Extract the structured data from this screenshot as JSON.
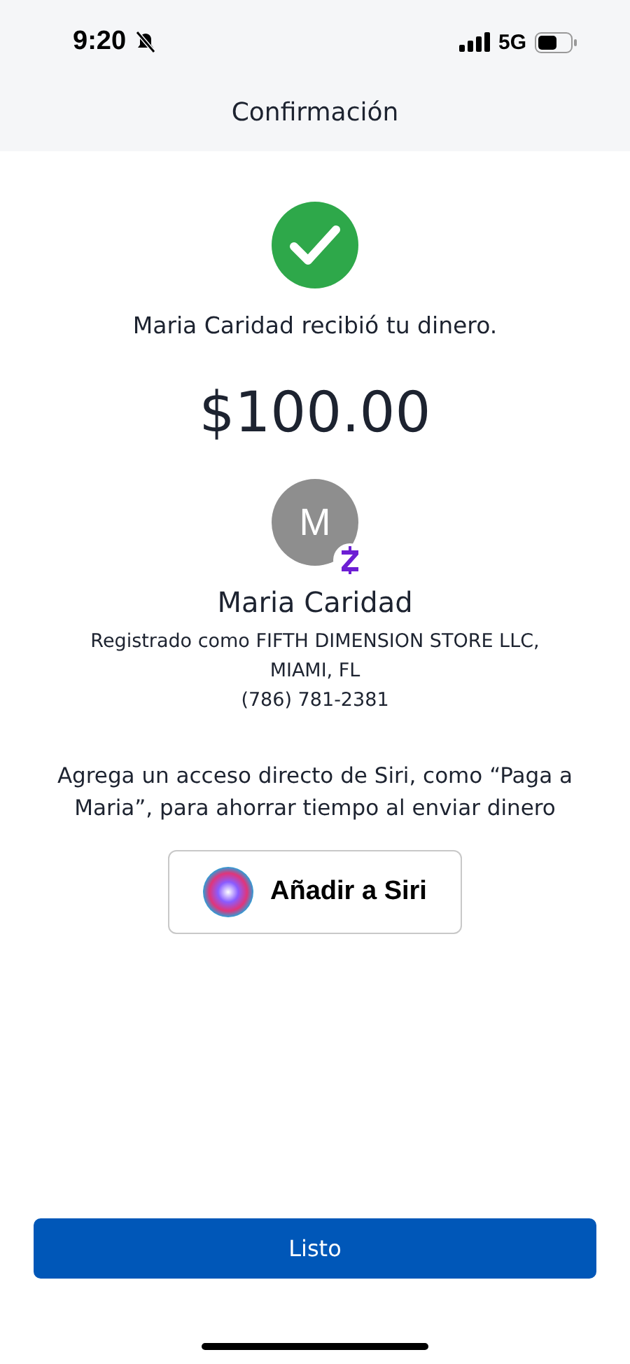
{
  "status_bar": {
    "time": "9:20",
    "network": "5G"
  },
  "header": {
    "title": "Confirmación"
  },
  "message": "Maria Caridad recibió tu dinero.",
  "amount": "$100.00",
  "recipient": {
    "initial": "M",
    "name": "Maria Caridad",
    "registered": "Registrado como FIFTH DIMENSION STORE LLC, MIAMI, FL",
    "phone": "(786) 781-2381"
  },
  "siri": {
    "hint": "Agrega un acceso directo de Siri, como “Paga a Maria”, para ahorrar tiempo al enviar dinero",
    "button": "Añadir a Siri"
  },
  "done_button": "Listo"
}
